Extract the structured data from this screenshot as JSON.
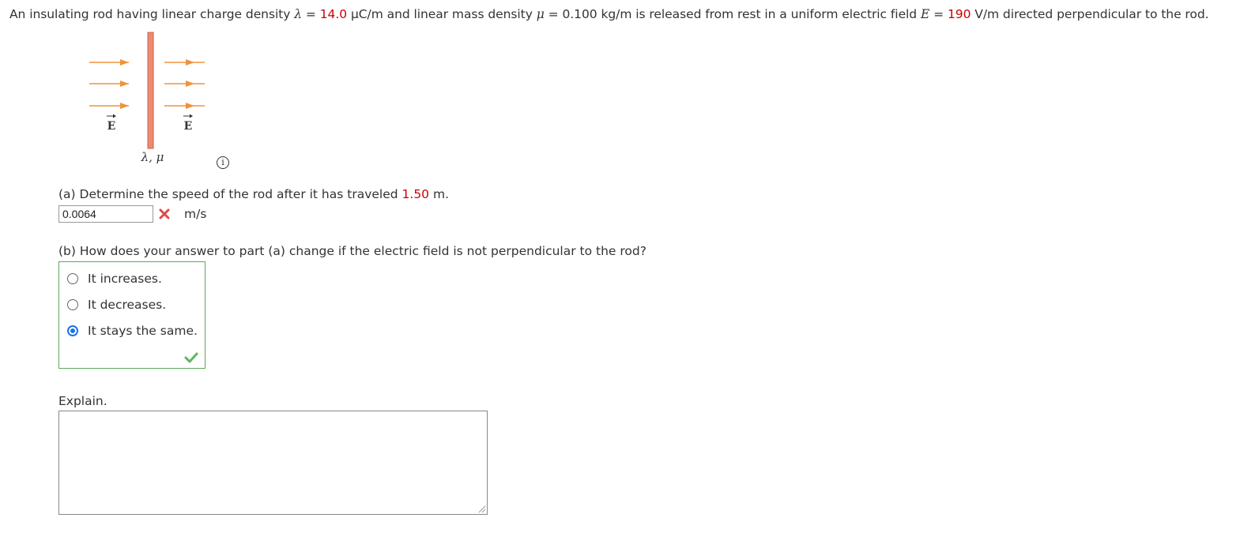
{
  "problem": {
    "t1": "An insulating rod having linear charge density ",
    "lambda_sym": "λ",
    "eq1": " = ",
    "lambda_val": "14.0",
    "t2": " μC/m and linear mass density ",
    "mu_sym": "μ",
    "eq2": " = 0.100 kg/m is released from rest in a uniform electric field ",
    "e_sym": "E",
    "eq3": " = ",
    "e_val": "190",
    "t3": " V/m directed perpendicular to the rod."
  },
  "figure": {
    "field_label_left": "E",
    "field_label_right": "E",
    "rod_label": "λ, μ",
    "arrow_color": "#f0923a",
    "rod_color": "#ee8a70"
  },
  "part_a": {
    "q_prefix": "(a) Determine the speed of the rod after it has traveled ",
    "distance": "1.50",
    "q_suffix": " m.",
    "answer_value": "0.0064",
    "unit": "m/s",
    "status": "incorrect"
  },
  "part_b": {
    "question": "(b) How does your answer to part (a) change if the electric field is not perpendicular to the rod?",
    "options": [
      "It increases.",
      "It decreases.",
      "It stays the same."
    ],
    "selected": "It stays the same.",
    "status": "correct"
  },
  "explain": {
    "label": "Explain.",
    "value": ""
  }
}
